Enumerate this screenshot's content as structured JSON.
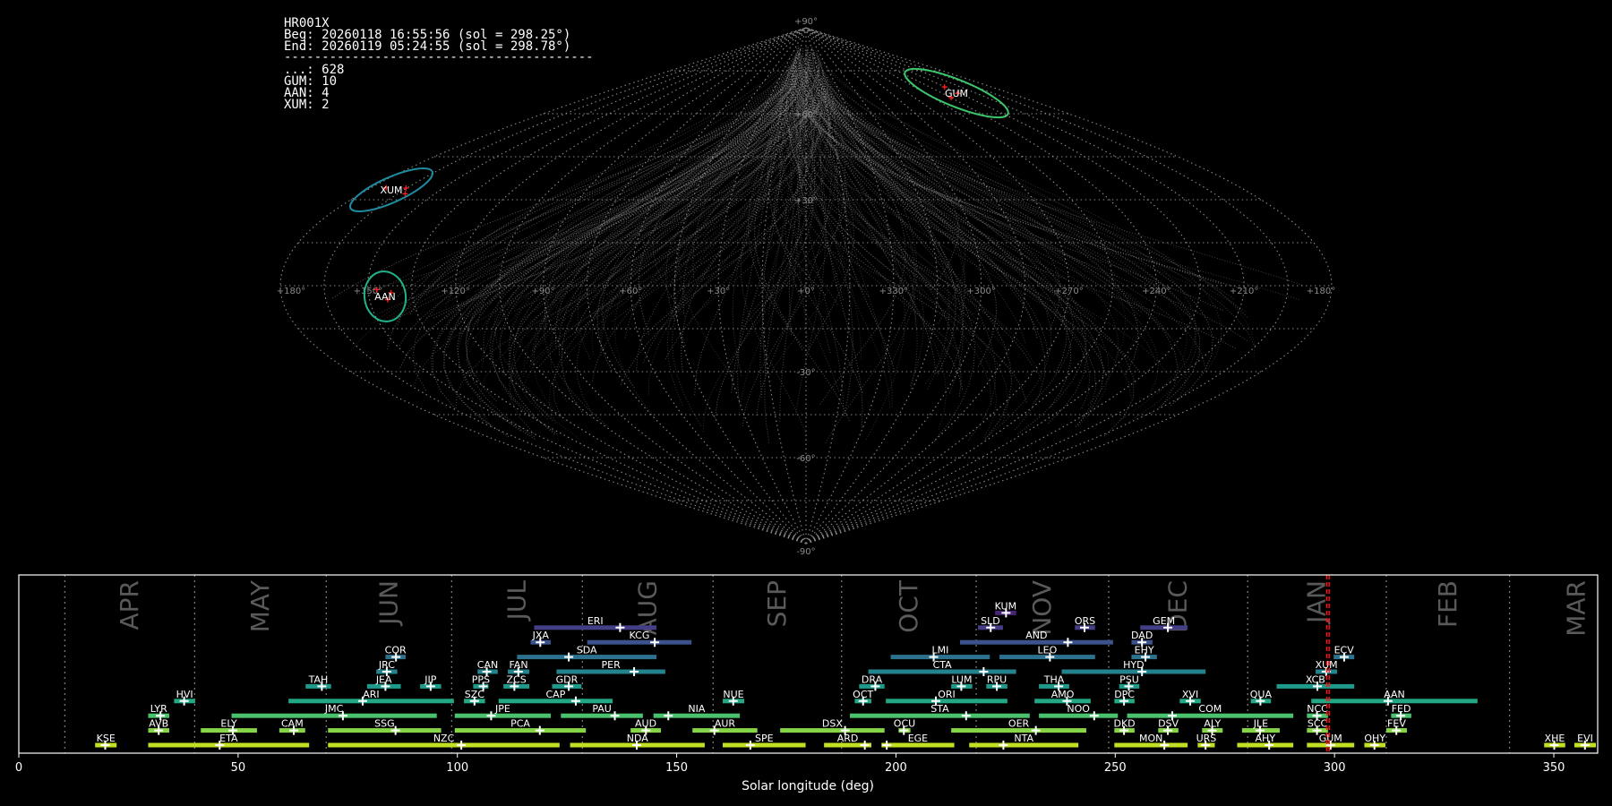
{
  "info": {
    "camera": "HR001X",
    "begin": "Beg: 20260118 16:55:56 (sol = 298.25°)",
    "end": "End: 20260119 05:24:55 (sol = 298.78°)",
    "separator": "-----------------------------------------",
    "counts": [
      "...: 628",
      "GUM: 10",
      "AAN: 4",
      "XUM: 2"
    ]
  },
  "chart_data": [
    {
      "type": "scatter",
      "projection": "sinusoidal",
      "lon_tick_labels": [
        "+180°",
        "+150°",
        "+120°",
        "+90°",
        "+60°",
        "+30°",
        "+0°",
        "+330°",
        "+300°",
        "+270°",
        "+240°",
        "+210°",
        "+180°"
      ],
      "lat_tick_labels": [
        "+90°",
        "+60°",
        "+30°",
        "-30°",
        "-60°",
        "-90°"
      ],
      "grid": true,
      "radiants": [
        {
          "name": "GUM",
          "color": "#3cc56a"
        },
        {
          "name": "XUM",
          "color": "#1f8a9e"
        },
        {
          "name": "AAN",
          "color": "#22b38a"
        }
      ],
      "trail_color": "#9a9a9a",
      "marker_color": "#ff2020"
    },
    {
      "type": "bar",
      "orientation": "horizontal-ranges",
      "xlabel": "Solar longitude (deg)",
      "xlim": [
        0,
        360
      ],
      "x_ticks": [
        0,
        50,
        100,
        150,
        200,
        250,
        300,
        350
      ],
      "month_boundaries": [
        10.5,
        40.1,
        70.1,
        98.7,
        128.5,
        158.3,
        187.6,
        218.3,
        248.5,
        280.2,
        311.8,
        339.9
      ],
      "months": [
        "APR",
        "MAY",
        "JUN",
        "JUL",
        "AUG",
        "SEP",
        "OCT",
        "NOV",
        "DEC",
        "JAN",
        "FEB",
        "MAR"
      ],
      "current_sol": [
        298.25,
        298.78
      ],
      "row_colors": [
        "#c2df23",
        "#86d549",
        "#4ac16d",
        "#22a884",
        "#1f9a8a",
        "#23848e",
        "#2c718e",
        "#3b528b",
        "#433e85",
        "#482576"
      ],
      "showers": [
        {
          "n": "KSE",
          "r": 0,
          "s": 17.4,
          "e": 22.3,
          "p": 19.7
        },
        {
          "n": "ETA",
          "r": 0,
          "s": 29.5,
          "e": 66.2,
          "p": 45.8
        },
        {
          "n": "NZC",
          "r": 0,
          "s": 70.5,
          "e": 123.3,
          "p": 100.9
        },
        {
          "n": "NDA",
          "r": 0,
          "s": 125.7,
          "e": 156.4,
          "p": 140.9
        },
        {
          "n": "SPE",
          "r": 0,
          "s": 160.5,
          "e": 179.4,
          "p": 166.8
        },
        {
          "n": "ARD",
          "r": 0,
          "s": 183.6,
          "e": 194.4,
          "p": 192.9
        },
        {
          "n": "EGE",
          "r": 0,
          "s": 196.7,
          "e": 213.3,
          "p": 197.9
        },
        {
          "n": "NTA",
          "r": 0,
          "s": 216.7,
          "e": 241.6,
          "p": 224.5
        },
        {
          "n": "MON",
          "r": 0,
          "s": 249.8,
          "e": 266.5,
          "p": 261.2
        },
        {
          "n": "URS",
          "r": 0,
          "s": 268.8,
          "e": 272.7,
          "p": 270.6
        },
        {
          "n": "AHY",
          "r": 0,
          "s": 277.8,
          "e": 290.6,
          "p": 285.1
        },
        {
          "n": "GUM",
          "r": 0,
          "s": 293.7,
          "e": 304.5,
          "p": 299.1
        },
        {
          "n": "OHY",
          "r": 0,
          "s": 306.8,
          "e": 311.6,
          "p": 309.1
        },
        {
          "n": "XHE",
          "r": 0,
          "s": 347.8,
          "e": 352.6,
          "p": 350.1
        },
        {
          "n": "EVI",
          "r": 0,
          "s": 354.7,
          "e": 359.6,
          "p": 357.1
        },
        {
          "n": "AVB",
          "r": 1,
          "s": 29.5,
          "e": 34.3,
          "p": 31.9
        },
        {
          "n": "ELY",
          "r": 1,
          "s": 41.5,
          "e": 54.3,
          "p": 48.8
        },
        {
          "n": "CAM",
          "r": 1,
          "s": 59.4,
          "e": 65.3,
          "p": 62.7
        },
        {
          "n": "SSG",
          "r": 1,
          "s": 70.5,
          "e": 96.3,
          "p": 85.9
        },
        {
          "n": "PCA",
          "r": 1,
          "s": 99.4,
          "e": 129.3,
          "p": 118.8
        },
        {
          "n": "AUD",
          "r": 1,
          "s": 139.5,
          "e": 146.4,
          "p": 143.0
        },
        {
          "n": "AUR",
          "r": 1,
          "s": 153.6,
          "e": 168.4,
          "p": 158.6
        },
        {
          "n": "DSX",
          "r": 1,
          "s": 173.6,
          "e": 197.4,
          "p": 188.4
        },
        {
          "n": "OCU",
          "r": 1,
          "s": 200.6,
          "e": 203.3,
          "p": 201.8
        },
        {
          "n": "OER",
          "r": 1,
          "s": 212.6,
          "e": 243.4,
          "p": 231.9
        },
        {
          "n": "DKD",
          "r": 1,
          "s": 249.8,
          "e": 254.4,
          "p": 252.0
        },
        {
          "n": "DSV",
          "r": 1,
          "s": 259.8,
          "e": 264.4,
          "p": 262.0
        },
        {
          "n": "ALY",
          "r": 1,
          "s": 269.8,
          "e": 274.5,
          "p": 272.1
        },
        {
          "n": "JLE",
          "r": 1,
          "s": 278.9,
          "e": 287.5,
          "p": 283.0
        },
        {
          "n": "SCC",
          "r": 1,
          "s": 293.7,
          "e": 298.5,
          "p": 296.0
        },
        {
          "n": "FEV",
          "r": 1,
          "s": 311.8,
          "e": 316.5,
          "p": 314.1
        },
        {
          "n": "LYR",
          "r": 2,
          "s": 29.5,
          "e": 34.3,
          "p": 32.3
        },
        {
          "n": "JMC",
          "r": 2,
          "s": 48.5,
          "e": 95.3,
          "p": 73.9
        },
        {
          "n": "JPE",
          "r": 2,
          "s": 99.4,
          "e": 121.3,
          "p": 107.7
        },
        {
          "n": "PAU",
          "r": 2,
          "s": 123.6,
          "e": 142.3,
          "p": 135.9
        },
        {
          "n": "NIA",
          "r": 2,
          "s": 144.7,
          "e": 164.4,
          "p": 148.1
        },
        {
          "n": "STA",
          "r": 2,
          "s": 189.5,
          "e": 230.5,
          "p": 216.0
        },
        {
          "n": "NOO",
          "r": 2,
          "s": 232.6,
          "e": 250.6,
          "p": 245.2
        },
        {
          "n": "COM",
          "r": 2,
          "s": 252.7,
          "e": 290.6,
          "p": 263.0
        },
        {
          "n": "NCC",
          "r": 2,
          "s": 293.7,
          "e": 298.5,
          "p": 296.0
        },
        {
          "n": "FED",
          "r": 2,
          "s": 312.9,
          "e": 317.5,
          "p": 315.1
        },
        {
          "n": "HVI",
          "r": 3,
          "s": 35.4,
          "e": 40.2,
          "p": 37.7
        },
        {
          "n": "ARI",
          "r": 3,
          "s": 61.5,
          "e": 99.2,
          "p": 78.4
        },
        {
          "n": "SZC",
          "r": 3,
          "s": 101.5,
          "e": 106.3,
          "p": 103.9
        },
        {
          "n": "CAP",
          "r": 3,
          "s": 109.4,
          "e": 135.4,
          "p": 127.0
        },
        {
          "n": "NUE",
          "r": 3,
          "s": 160.5,
          "e": 165.4,
          "p": 162.9
        },
        {
          "n": "OCT",
          "r": 3,
          "s": 190.6,
          "e": 194.4,
          "p": 192.5
        },
        {
          "n": "ORI",
          "r": 3,
          "s": 197.7,
          "e": 225.4,
          "p": 209.1
        },
        {
          "n": "AMO",
          "r": 3,
          "s": 231.6,
          "e": 244.4,
          "p": 239.0
        },
        {
          "n": "DPC",
          "r": 3,
          "s": 249.8,
          "e": 254.4,
          "p": 252.0
        },
        {
          "n": "XVI",
          "r": 3,
          "s": 264.7,
          "e": 269.5,
          "p": 267.1
        },
        {
          "n": "QUA",
          "r": 3,
          "s": 280.9,
          "e": 285.5,
          "p": 283.1
        },
        {
          "n": "AAN",
          "r": 3,
          "s": 294.7,
          "e": 332.6,
          "p": 312.2
        },
        {
          "n": "TAH",
          "r": 4,
          "s": 65.4,
          "e": 71.2,
          "p": 69.1
        },
        {
          "n": "JEA",
          "r": 4,
          "s": 79.4,
          "e": 87.1,
          "p": 83.6
        },
        {
          "n": "JIP",
          "r": 4,
          "s": 91.5,
          "e": 96.3,
          "p": 93.9
        },
        {
          "n": "PPS",
          "r": 4,
          "s": 103.6,
          "e": 107.1,
          "p": 105.9
        },
        {
          "n": "ZCS",
          "r": 4,
          "s": 110.5,
          "e": 116.4,
          "p": 113.0
        },
        {
          "n": "GDR",
          "r": 4,
          "s": 121.6,
          "e": 128.3,
          "p": 125.4
        },
        {
          "n": "DRA",
          "r": 4,
          "s": 191.6,
          "e": 197.4,
          "p": 195.3
        },
        {
          "n": "LUM",
          "r": 4,
          "s": 212.6,
          "e": 217.4,
          "p": 214.9
        },
        {
          "n": "RPU",
          "r": 4,
          "s": 220.6,
          "e": 225.4,
          "p": 223.0
        },
        {
          "n": "THA",
          "r": 4,
          "s": 232.6,
          "e": 239.5,
          "p": 237.1
        },
        {
          "n": "PSU",
          "r": 4,
          "s": 250.9,
          "e": 255.5,
          "p": 253.1
        },
        {
          "n": "XCB",
          "r": 4,
          "s": 286.8,
          "e": 304.5,
          "p": 296.1
        },
        {
          "n": "JRC",
          "r": 5,
          "s": 81.5,
          "e": 86.3,
          "p": 83.9
        },
        {
          "n": "CAN",
          "r": 5,
          "s": 104.6,
          "e": 109.2,
          "p": 106.7
        },
        {
          "n": "FAN",
          "r": 5,
          "s": 111.5,
          "e": 116.4,
          "p": 113.9
        },
        {
          "n": "PER",
          "r": 5,
          "s": 122.6,
          "e": 147.4,
          "p": 140.3
        },
        {
          "n": "CTA",
          "r": 5,
          "s": 193.7,
          "e": 227.4,
          "p": 220.0
        },
        {
          "n": "HYD",
          "r": 5,
          "s": 237.8,
          "e": 270.6,
          "p": 256.1
        },
        {
          "n": "XUM",
          "r": 5,
          "s": 295.7,
          "e": 300.6,
          "p": 298.1
        },
        {
          "n": "COR",
          "r": 6,
          "s": 83.6,
          "e": 88.2,
          "p": 86.0
        },
        {
          "n": "SDA",
          "r": 6,
          "s": 113.6,
          "e": 145.4,
          "p": 125.4
        },
        {
          "n": "LMI",
          "r": 6,
          "s": 198.8,
          "e": 221.4,
          "p": 208.6
        },
        {
          "n": "LEO",
          "r": 6,
          "s": 223.6,
          "e": 245.4,
          "p": 235.1
        },
        {
          "n": "EHY",
          "r": 6,
          "s": 253.7,
          "e": 259.5,
          "p": 256.9
        },
        {
          "n": "ECV",
          "r": 6,
          "s": 299.8,
          "e": 304.5,
          "p": 302.2
        },
        {
          "n": "JXA",
          "r": 7,
          "s": 116.7,
          "e": 121.3,
          "p": 118.9
        },
        {
          "n": "KCG",
          "r": 7,
          "s": 129.6,
          "e": 153.4,
          "p": 145.0
        },
        {
          "n": "AND",
          "r": 7,
          "s": 214.6,
          "e": 249.5,
          "p": 239.2
        },
        {
          "n": "DAD",
          "r": 7,
          "s": 253.7,
          "e": 258.5,
          "p": 256.1
        },
        {
          "n": "ERI",
          "r": 8,
          "s": 117.5,
          "e": 145.4,
          "p": 137.1
        },
        {
          "n": "SLD",
          "r": 8,
          "s": 218.7,
          "e": 224.4,
          "p": 221.6
        },
        {
          "n": "ORS",
          "r": 8,
          "s": 240.8,
          "e": 245.4,
          "p": 243.0
        },
        {
          "n": "GEM",
          "r": 8,
          "s": 255.7,
          "e": 266.5,
          "p": 262.0
        },
        {
          "n": "KUM",
          "r": 9,
          "s": 222.6,
          "e": 227.4,
          "p": 225.1
        }
      ]
    }
  ]
}
